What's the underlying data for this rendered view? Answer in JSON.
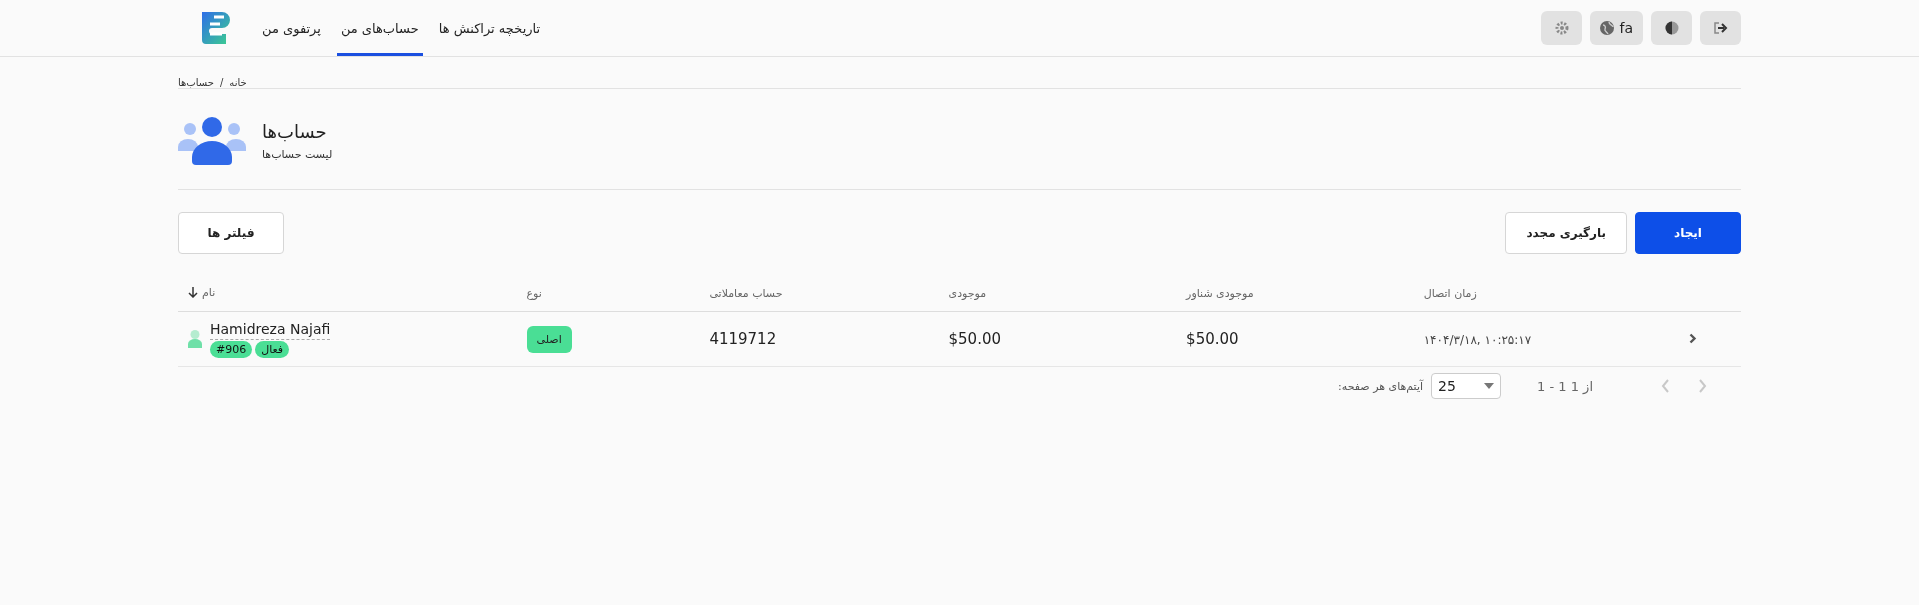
{
  "header": {
    "nav": [
      {
        "label": "تاریخچه تراکنش ها",
        "selected": false
      },
      {
        "label": "حساب‌های من",
        "selected": true
      },
      {
        "label": "پرتفوی من",
        "selected": false
      }
    ],
    "language": "fa"
  },
  "breadcrumb": {
    "items": [
      "خانه",
      "حساب‌ها"
    ],
    "separator": "/"
  },
  "page": {
    "title": "حساب‌ها",
    "subtitle": "لیست حساب‌ها"
  },
  "toolbar": {
    "filters": "فیلتر ها",
    "reload": "بارگیری مجدد",
    "create": "ایجاد"
  },
  "table": {
    "columns": [
      {
        "label": "زمان اتصال",
        "sorted": false
      },
      {
        "label": "موجودی شناور",
        "sorted": false
      },
      {
        "label": "موجودی",
        "sorted": false
      },
      {
        "label": "حساب معاملاتی",
        "sorted": false
      },
      {
        "label": "نوع",
        "sorted": false
      },
      {
        "label": "نام",
        "sorted": true
      }
    ],
    "rows": [
      {
        "name": "Hamidreza Najafi",
        "id": "#906",
        "status": "فعال",
        "type": "اصلی",
        "account": "4119712",
        "balance": "$50.00",
        "floating": "$50.00",
        "connected": "۱۴۰۴/۳/۱۸, ۱۰:۲۵:۱۷"
      }
    ]
  },
  "pagination": {
    "per_page_label": "آیتم‌های هر صفحه:",
    "per_page": "25",
    "range": "1 - 1 از 1",
    "prev_disabled": true,
    "next_disabled": true
  }
}
